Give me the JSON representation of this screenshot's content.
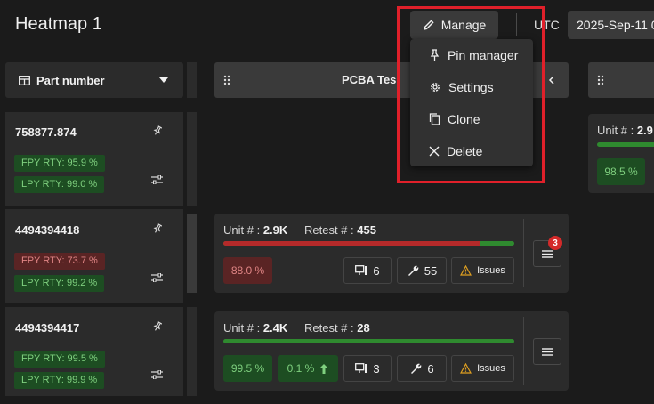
{
  "header": {
    "title": "Heatmap 1",
    "manage_label": "Manage",
    "timezone": "UTC",
    "date": "2025-Sep-11 0"
  },
  "dropdown": {
    "items": [
      {
        "label": "Pin manager",
        "icon": "pin-icon"
      },
      {
        "label": "Settings",
        "icon": "gear-icon"
      },
      {
        "label": "Clone",
        "icon": "copy-icon"
      },
      {
        "label": "Delete",
        "icon": "close-icon"
      }
    ]
  },
  "columns": {
    "part_header": "Part number",
    "pcba_header": "PCBA Tes"
  },
  "rows": [
    {
      "part_number": "758877.874",
      "fpy": "FPY RTY: 95.9 %",
      "fpy_status": "good",
      "lpy": "LPY RTY: 99.0 %",
      "side_card": {
        "unit_label": "Unit # :",
        "unit_value": "2.9",
        "yield": "98.5 %"
      }
    },
    {
      "part_number": "4494394418",
      "fpy": "FPY RTY: 73.7 %",
      "fpy_status": "bad",
      "lpy": "LPY RTY: 99.2 %",
      "card": {
        "unit_label": "Unit # :",
        "unit_value": "2.9K",
        "retest_label": "Retest # :",
        "retest_value": "455",
        "bar_fraction": 0.88,
        "yield": "88.0 %",
        "station_count": "6",
        "repair_count": "55",
        "issues_label": "Issues",
        "notification_count": "3"
      }
    },
    {
      "part_number": "4494394417",
      "fpy": "FPY RTY: 99.5 %",
      "fpy_status": "good",
      "lpy": "LPY RTY: 99.9 %",
      "card": {
        "unit_label": "Unit # :",
        "unit_value": "2.4K",
        "retest_label": "Retest # :",
        "retest_value": "28",
        "bar_fraction": 1.0,
        "yield": "99.5 %",
        "delta": "0.1 %",
        "station_count": "3",
        "repair_count": "6",
        "issues_label": "Issues"
      }
    }
  ],
  "colors": {
    "accent_highlight": "#e0202a",
    "good": "#2f8a2f",
    "bad": "#b52a2a",
    "warning": "#e0a020"
  }
}
